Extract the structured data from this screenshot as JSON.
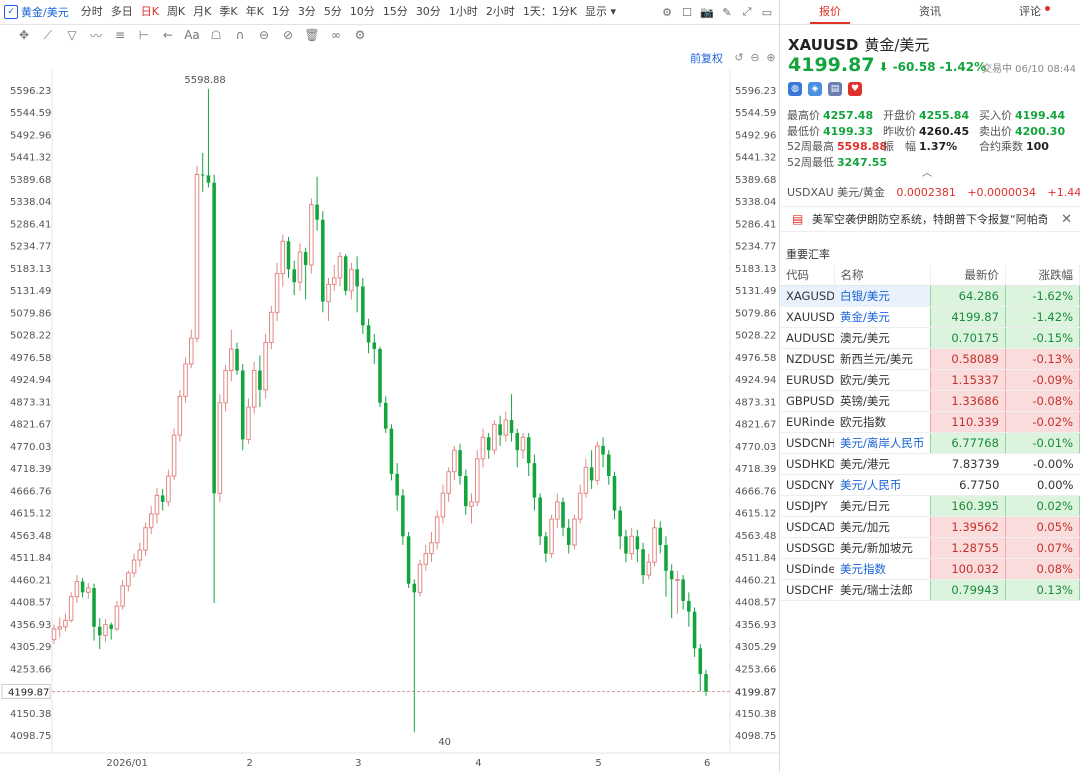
{
  "topbar": {
    "symbol_tab": "黄金/美元",
    "timeframes": [
      "分时",
      "多日",
      "日K",
      "周K",
      "月K",
      "季K",
      "年K",
      "1分",
      "3分",
      "5分",
      "10分",
      "15分",
      "30分",
      "1小时",
      "2小时",
      "1天：1分K"
    ],
    "active_timeframe": "日K",
    "display_label": "显示"
  },
  "chart": {
    "adjust_label": "前复权",
    "high_label": "5598.88",
    "low_label": "40",
    "current_price": "4199.87",
    "yticks": [
      "5596.23",
      "5544.59",
      "5492.96",
      "5441.32",
      "5389.68",
      "5338.04",
      "5286.41",
      "5234.77",
      "5183.13",
      "5131.49",
      "5079.86",
      "5028.22",
      "4976.58",
      "4924.94",
      "4873.31",
      "4821.67",
      "4770.03",
      "4718.39",
      "4666.76",
      "4615.12",
      "4563.48",
      "4511.84",
      "4460.21",
      "4408.57",
      "4356.93",
      "4305.29",
      "4253.66",
      "4199.87",
      "4150.38",
      "4098.75"
    ],
    "xticks": [
      "2026/01",
      "2",
      "3",
      "4",
      "5",
      "6"
    ]
  },
  "chart_data": {
    "type": "candlestick",
    "ylim": [
      4080,
      5620
    ],
    "yticks": [
      5596.23,
      5544.59,
      5492.96,
      5441.32,
      5389.68,
      5338.04,
      5286.41,
      5234.77,
      5183.13,
      5131.49,
      5079.86,
      5028.22,
      4976.58,
      4924.94,
      4873.31,
      4821.67,
      4770.03,
      4718.39,
      4666.76,
      4615.12,
      4563.48,
      4511.84,
      4460.21,
      4408.57,
      4356.93,
      4305.29,
      4253.66,
      4199.87,
      4150.38,
      4098.75
    ],
    "xticks": [
      {
        "label": "2026/01",
        "index": 13
      },
      {
        "label": "2",
        "index": 34
      },
      {
        "label": "3",
        "index": 53
      },
      {
        "label": "4",
        "index": 74
      },
      {
        "label": "5",
        "index": 95
      },
      {
        "label": "6",
        "index": 114
      }
    ],
    "current_price": 4199.87,
    "candles": [
      [
        4320,
        4345,
        4310,
        4355
      ],
      [
        4345,
        4350,
        4325,
        4372
      ],
      [
        4350,
        4365,
        4340,
        4380
      ],
      [
        4365,
        4420,
        4360,
        4430
      ],
      [
        4420,
        4455,
        4405,
        4470
      ],
      [
        4455,
        4430,
        4418,
        4463
      ],
      [
        4430,
        4440,
        4415,
        4452
      ],
      [
        4440,
        4350,
        4318,
        4450
      ],
      [
        4350,
        4330,
        4298,
        4370
      ],
      [
        4330,
        4355,
        4315,
        4368
      ],
      [
        4355,
        4345,
        4320,
        4360
      ],
      [
        4345,
        4398,
        4340,
        4410
      ],
      [
        4398,
        4445,
        4390,
        4458
      ],
      [
        4445,
        4475,
        4432,
        4480
      ],
      [
        4475,
        4505,
        4465,
        4520
      ],
      [
        4505,
        4528,
        4490,
        4545
      ],
      [
        4528,
        4580,
        4515,
        4592
      ],
      [
        4580,
        4612,
        4565,
        4630
      ],
      [
        4612,
        4655,
        4590,
        4672
      ],
      [
        4655,
        4640,
        4620,
        4670
      ],
      [
        4640,
        4700,
        4630,
        4715
      ],
      [
        4700,
        4795,
        4690,
        4810
      ],
      [
        4795,
        4885,
        4780,
        4900
      ],
      [
        4885,
        4960,
        4870,
        4975
      ],
      [
        4960,
        5020,
        4950,
        5040
      ],
      [
        5020,
        5400,
        5010,
        5420
      ],
      [
        5400,
        5398,
        5360,
        5450
      ],
      [
        5398,
        5381,
        5370,
        5598.88
      ],
      [
        5381,
        4660,
        4405,
        5400
      ],
      [
        4660,
        4870,
        4640,
        4890
      ],
      [
        4870,
        4945,
        4850,
        4958
      ],
      [
        4945,
        4995,
        4920,
        5040
      ],
      [
        4995,
        4945,
        4935,
        5010
      ],
      [
        4945,
        4785,
        4760,
        4960
      ],
      [
        4785,
        4860,
        4775,
        4880
      ],
      [
        4860,
        4945,
        4845,
        4965
      ],
      [
        4945,
        4900,
        4860,
        4980
      ],
      [
        4900,
        5010,
        4880,
        5030
      ],
      [
        5010,
        5080,
        4995,
        5095
      ],
      [
        5080,
        5170,
        5060,
        5195
      ],
      [
        5170,
        5245,
        5140,
        5260
      ],
      [
        5245,
        5180,
        5160,
        5255
      ],
      [
        5180,
        5150,
        5120,
        5200
      ],
      [
        5150,
        5220,
        5130,
        5240
      ],
      [
        5220,
        5190,
        5110,
        5230
      ],
      [
        5190,
        5330,
        5170,
        5345
      ],
      [
        5330,
        5295,
        5270,
        5395
      ],
      [
        5295,
        5105,
        5080,
        5315
      ],
      [
        5105,
        5145,
        5060,
        5160
      ],
      [
        5145,
        5160,
        5130,
        5190
      ],
      [
        5160,
        5210,
        5140,
        5220
      ],
      [
        5210,
        5130,
        5120,
        5215
      ],
      [
        5130,
        5180,
        5110,
        5195
      ],
      [
        5180,
        5140,
        5080,
        5210
      ],
      [
        5140,
        5050,
        5030,
        5160
      ],
      [
        5050,
        5010,
        4985,
        5065
      ],
      [
        5010,
        4995,
        4960,
        5030
      ],
      [
        4995,
        4870,
        4860,
        5000
      ],
      [
        4870,
        4810,
        4800,
        4885
      ],
      [
        4810,
        4705,
        4690,
        4820
      ],
      [
        4705,
        4655,
        4620,
        4730
      ],
      [
        4655,
        4560,
        4540,
        4670
      ],
      [
        4560,
        4450,
        4440,
        4570
      ],
      [
        4450,
        4430,
        4105,
        4460
      ],
      [
        4430,
        4495,
        4420,
        4505
      ],
      [
        4495,
        4520,
        4480,
        4540
      ],
      [
        4520,
        4545,
        4500,
        4570
      ],
      [
        4545,
        4605,
        4530,
        4620
      ],
      [
        4605,
        4660,
        4590,
        4680
      ],
      [
        4660,
        4710,
        4640,
        4720
      ],
      [
        4710,
        4760,
        4690,
        4770
      ],
      [
        4760,
        4700,
        4680,
        4775
      ],
      [
        4700,
        4630,
        4610,
        4715
      ],
      [
        4630,
        4640,
        4590,
        4660
      ],
      [
        4640,
        4740,
        4630,
        4760
      ],
      [
        4740,
        4790,
        4720,
        4810
      ],
      [
        4790,
        4760,
        4740,
        4800
      ],
      [
        4760,
        4820,
        4750,
        4830
      ],
      [
        4820,
        4795,
        4770,
        4840
      ],
      [
        4795,
        4830,
        4780,
        4850
      ],
      [
        4830,
        4800,
        4780,
        4890
      ],
      [
        4800,
        4760,
        4720,
        4810
      ],
      [
        4760,
        4790,
        4740,
        4800
      ],
      [
        4790,
        4730,
        4700,
        4800
      ],
      [
        4730,
        4650,
        4620,
        4750
      ],
      [
        4650,
        4560,
        4540,
        4660
      ],
      [
        4560,
        4520,
        4500,
        4570
      ],
      [
        4520,
        4600,
        4510,
        4610
      ],
      [
        4600,
        4640,
        4580,
        4660
      ],
      [
        4640,
        4580,
        4560,
        4650
      ],
      [
        4580,
        4540,
        4520,
        4600
      ],
      [
        4540,
        4600,
        4530,
        4610
      ],
      [
        4600,
        4660,
        4590,
        4680
      ],
      [
        4660,
        4720,
        4650,
        4740
      ],
      [
        4720,
        4690,
        4670,
        4760
      ],
      [
        4690,
        4770,
        4680,
        4780
      ],
      [
        4770,
        4750,
        4720,
        4790
      ],
      [
        4750,
        4700,
        4680,
        4760
      ],
      [
        4700,
        4620,
        4600,
        4710
      ],
      [
        4620,
        4560,
        4530,
        4630
      ],
      [
        4560,
        4520,
        4500,
        4575
      ],
      [
        4520,
        4560,
        4505,
        4580
      ],
      [
        4560,
        4530,
        4500,
        4575
      ],
      [
        4530,
        4470,
        4450,
        4545
      ],
      [
        4470,
        4500,
        4460,
        4520
      ],
      [
        4500,
        4580,
        4490,
        4600
      ],
      [
        4580,
        4540,
        4520,
        4595
      ],
      [
        4540,
        4480,
        4420,
        4560
      ],
      [
        4480,
        4460,
        4370,
        4495
      ],
      [
        4460,
        4460,
        4380,
        4480
      ],
      [
        4460,
        4410,
        4390,
        4470
      ],
      [
        4410,
        4385,
        4350,
        4430
      ],
      [
        4385,
        4300,
        4280,
        4395
      ],
      [
        4300,
        4240,
        4200,
        4310
      ],
      [
        4240,
        4199.87,
        4190,
        4250
      ]
    ]
  },
  "quote": {
    "symbol": "XAUUSD",
    "name": "黄金/美元",
    "price": "4199.87",
    "arrow": "⬇",
    "change": "-60.58",
    "change_pct": "-1.42%",
    "status": "交易中 06/10 08:44",
    "stats": [
      [
        {
          "label": "最高价",
          "value": "4257.48",
          "c": "g"
        },
        {
          "label": "开盘价",
          "value": "4255.84",
          "c": "g"
        },
        {
          "label": "买入价",
          "value": "4199.44",
          "c": "g"
        }
      ],
      [
        {
          "label": "最低价",
          "value": "4199.33",
          "c": "g"
        },
        {
          "label": "昨收价",
          "value": "4260.45",
          "c": "k"
        },
        {
          "label": "卖出价",
          "value": "4200.30",
          "c": "g"
        }
      ],
      [
        {
          "label": "52周最高",
          "value": "5598.88",
          "c": "r"
        },
        {
          "label": "振　幅",
          "value": "1.37%",
          "c": "k"
        },
        {
          "label": "合约乘数",
          "value": "100",
          "c": "k"
        }
      ],
      [
        {
          "label": "52周最低",
          "value": "3247.55",
          "c": "g"
        }
      ]
    ],
    "usdxau": {
      "label": "USDXAU 美元/黄金",
      "price": "0.0002381",
      "change": "+0.0000034",
      "pct": "+1.44%"
    }
  },
  "right_tabs": [
    "报价",
    "资讯",
    "评论"
  ],
  "news": "美军空袭伊朗防空系统，特朗普下令报复“阿帕奇”",
  "rates": {
    "title": "重要汇率",
    "headers": [
      "代码",
      "名称",
      "最新价",
      "涨跌幅"
    ],
    "rows": [
      {
        "code": "XAGUSD",
        "name": "白银/美元",
        "price": "64.286",
        "pct": "-1.62%",
        "dir": "down",
        "link": true,
        "sel": true
      },
      {
        "code": "XAUUSD",
        "name": "黄金/美元",
        "price": "4199.87",
        "pct": "-1.42%",
        "dir": "down",
        "link": true
      },
      {
        "code": "AUDUSD",
        "name": "澳元/美元",
        "price": "0.70175",
        "pct": "-0.15%",
        "dir": "down"
      },
      {
        "code": "NZDUSD",
        "name": "新西兰元/美元",
        "price": "0.58089",
        "pct": "-0.13%",
        "dir": "up"
      },
      {
        "code": "EURUSD",
        "name": "欧元/美元",
        "price": "1.15337",
        "pct": "-0.09%",
        "dir": "up"
      },
      {
        "code": "GBPUSD",
        "name": "英镑/美元",
        "price": "1.33686",
        "pct": "-0.08%",
        "dir": "up"
      },
      {
        "code": "EURindex",
        "name": "欧元指数",
        "price": "110.339",
        "pct": "-0.02%",
        "dir": "up"
      },
      {
        "code": "USDCNH",
        "name": "美元/离岸人民币",
        "price": "6.77768",
        "pct": "-0.01%",
        "dir": "down",
        "link": true
      },
      {
        "code": "USDHKD",
        "name": "美元/港元",
        "price": "7.83739",
        "pct": "-0.00%",
        "dir": "flat"
      },
      {
        "code": "USDCNY",
        "name": "美元/人民币",
        "price": "6.7750",
        "pct": "0.00%",
        "dir": "flat",
        "link": true
      },
      {
        "code": "USDJPY",
        "name": "美元/日元",
        "price": "160.395",
        "pct": "0.02%",
        "dir": "down"
      },
      {
        "code": "USDCAD",
        "name": "美元/加元",
        "price": "1.39562",
        "pct": "0.05%",
        "dir": "up"
      },
      {
        "code": "USDSGD",
        "name": "美元/新加坡元",
        "price": "1.28755",
        "pct": "0.07%",
        "dir": "up"
      },
      {
        "code": "USDindex",
        "name": "美元指数",
        "price": "100.032",
        "pct": "0.08%",
        "dir": "up",
        "link": true
      },
      {
        "code": "USDCHF",
        "name": "美元/瑞士法郎",
        "price": "0.79943",
        "pct": "0.13%",
        "dir": "down"
      }
    ]
  },
  "colors": {
    "up": "#e0302a",
    "down": "#13a43e",
    "accent": "#1a63d8"
  }
}
